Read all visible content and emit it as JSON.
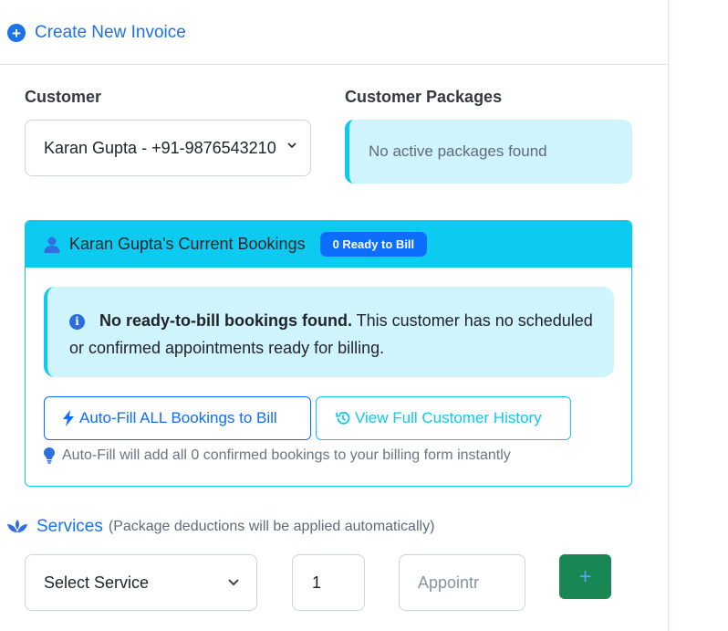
{
  "header": {
    "title": "Create New Invoice"
  },
  "customer": {
    "label": "Customer",
    "selected": "Karan Gupta - +91-9876543210"
  },
  "packages": {
    "label": "Customer Packages",
    "message": "No active packages found"
  },
  "bookings": {
    "title": "Karan Gupta's Current Bookings",
    "badge": "0 Ready to Bill",
    "alert_bold": "No ready-to-bill bookings found.",
    "alert_text": " This customer has no scheduled or confirmed appointments ready for billing.",
    "autofill_label": "Auto-Fill ALL Bookings to Bill",
    "history_label": "View Full Customer History",
    "hint": "Auto-Fill will add all 0 confirmed bookings to your billing form instantly"
  },
  "services": {
    "title": "Services",
    "subtitle": "(Package deductions will be applied automatically)",
    "select_placeholder": "Select Service",
    "quantity": "1",
    "appointment_placeholder": "Appointr",
    "add_label": "+"
  },
  "colors": {
    "primary": "#1a73e8",
    "info": "#0dcaf0",
    "badge": "#0d6efd",
    "success": "#198754"
  }
}
